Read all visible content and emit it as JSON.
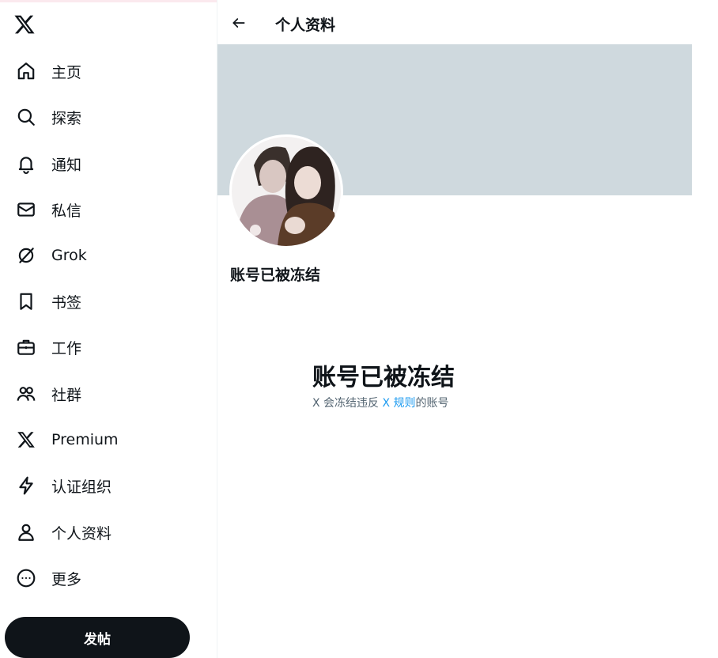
{
  "sidebar": {
    "logo": "x-logo-icon",
    "items": [
      {
        "label": "主页",
        "icon": "home-icon"
      },
      {
        "label": "探索",
        "icon": "search-icon"
      },
      {
        "label": "通知",
        "icon": "bell-icon"
      },
      {
        "label": "私信",
        "icon": "envelope-icon"
      },
      {
        "label": "Grok",
        "icon": "grok-icon"
      },
      {
        "label": "书签",
        "icon": "bookmark-icon"
      },
      {
        "label": "工作",
        "icon": "briefcase-icon"
      },
      {
        "label": "社群",
        "icon": "people-icon"
      },
      {
        "label": "Premium",
        "icon": "x-logo-icon"
      },
      {
        "label": "认证组织",
        "icon": "lightning-icon"
      },
      {
        "label": "个人资料",
        "icon": "person-icon"
      },
      {
        "label": "更多",
        "icon": "more-circle-icon"
      }
    ],
    "post_button": "发帖"
  },
  "header": {
    "title": "个人资料",
    "back_icon": "arrow-left-icon"
  },
  "profile": {
    "name": "账号已被冻结",
    "banner_color": "#cfd9de"
  },
  "suspended": {
    "title": "账号已被冻结",
    "desc_before": "X 会冻结违反 ",
    "desc_link": "X 规则",
    "desc_after": "的账号"
  },
  "colors": {
    "text": "#0f1419",
    "secondary": "#536471",
    "link": "#1d9bf0",
    "button": "#0f1419"
  }
}
